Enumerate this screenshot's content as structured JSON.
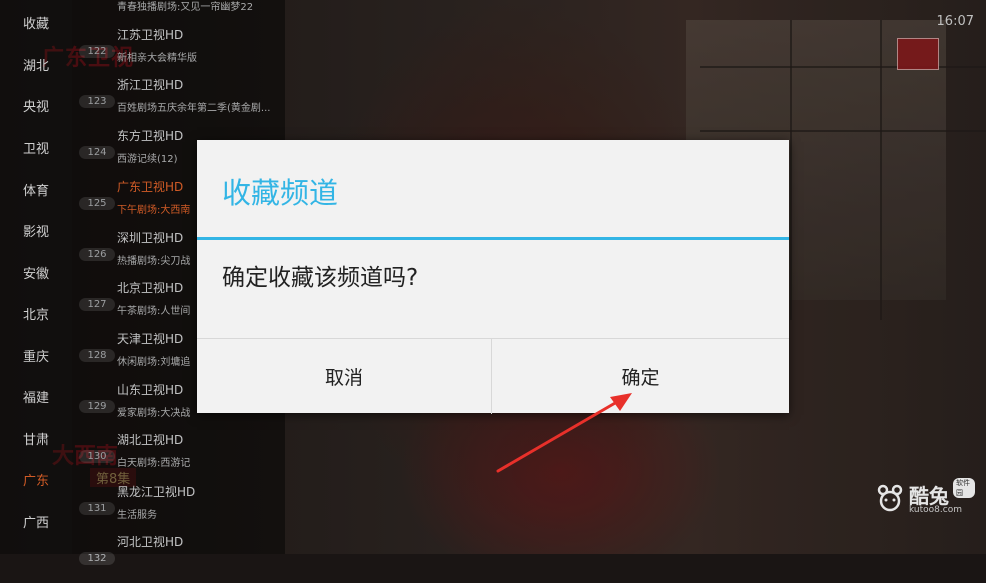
{
  "clock": "16:07",
  "categories": [
    {
      "label": "收藏",
      "active": false
    },
    {
      "label": "湖北",
      "active": false
    },
    {
      "label": "央视",
      "active": false
    },
    {
      "label": "卫视",
      "active": false
    },
    {
      "label": "体育",
      "active": false
    },
    {
      "label": "影视",
      "active": false
    },
    {
      "label": "安徽",
      "active": false
    },
    {
      "label": "北京",
      "active": false
    },
    {
      "label": "重庆",
      "active": false
    },
    {
      "label": "福建",
      "active": false
    },
    {
      "label": "甘肃",
      "active": false
    },
    {
      "label": "广东",
      "active": true
    },
    {
      "label": "广西",
      "active": false
    }
  ],
  "top_program": "青春独播剧场:又见一帘幽梦22",
  "channels": [
    {
      "num": "122",
      "name": "江苏卫视HD",
      "program": "新相亲大会精华版",
      "active": false
    },
    {
      "num": "123",
      "name": "浙江卫视HD",
      "program": "百姓剧场五庆余年第二季(黄金剧...",
      "active": false
    },
    {
      "num": "124",
      "name": "东方卫视HD",
      "program": "西游记续(12)",
      "active": false
    },
    {
      "num": "125",
      "name": "广东卫视HD",
      "program": "下午剧场:大西南",
      "active": true
    },
    {
      "num": "126",
      "name": "深圳卫视HD",
      "program": "热播剧场:尖刀战",
      "active": false
    },
    {
      "num": "127",
      "name": "北京卫视HD",
      "program": "午茶剧场:人世间",
      "active": false
    },
    {
      "num": "128",
      "name": "天津卫视HD",
      "program": "休闲剧场:刘墉追",
      "active": false
    },
    {
      "num": "129",
      "name": "山东卫视HD",
      "program": "爱家剧场:大决战",
      "active": false
    },
    {
      "num": "130",
      "name": "湖北卫视HD",
      "program": "白天剧场:西游记",
      "active": false
    },
    {
      "num": "131",
      "name": "黑龙江卫视HD",
      "program": "生活服务",
      "active": false
    },
    {
      "num": "132",
      "name": "河北卫视HD",
      "program": "",
      "active": false
    }
  ],
  "video": {
    "logo_text": "广东卫视",
    "drama_title": "大西南",
    "episode": "第8集"
  },
  "dialog": {
    "title": "收藏频道",
    "message": "确定收藏该频道吗?",
    "cancel_label": "取消",
    "ok_label": "确定"
  },
  "watermark": {
    "name": "酷兔",
    "site": "kutoo8.com",
    "tag": "软件园"
  },
  "colors": {
    "accent": "#33b5e5",
    "active_orange": "#e8662b",
    "arrow_red": "#e8302a"
  }
}
